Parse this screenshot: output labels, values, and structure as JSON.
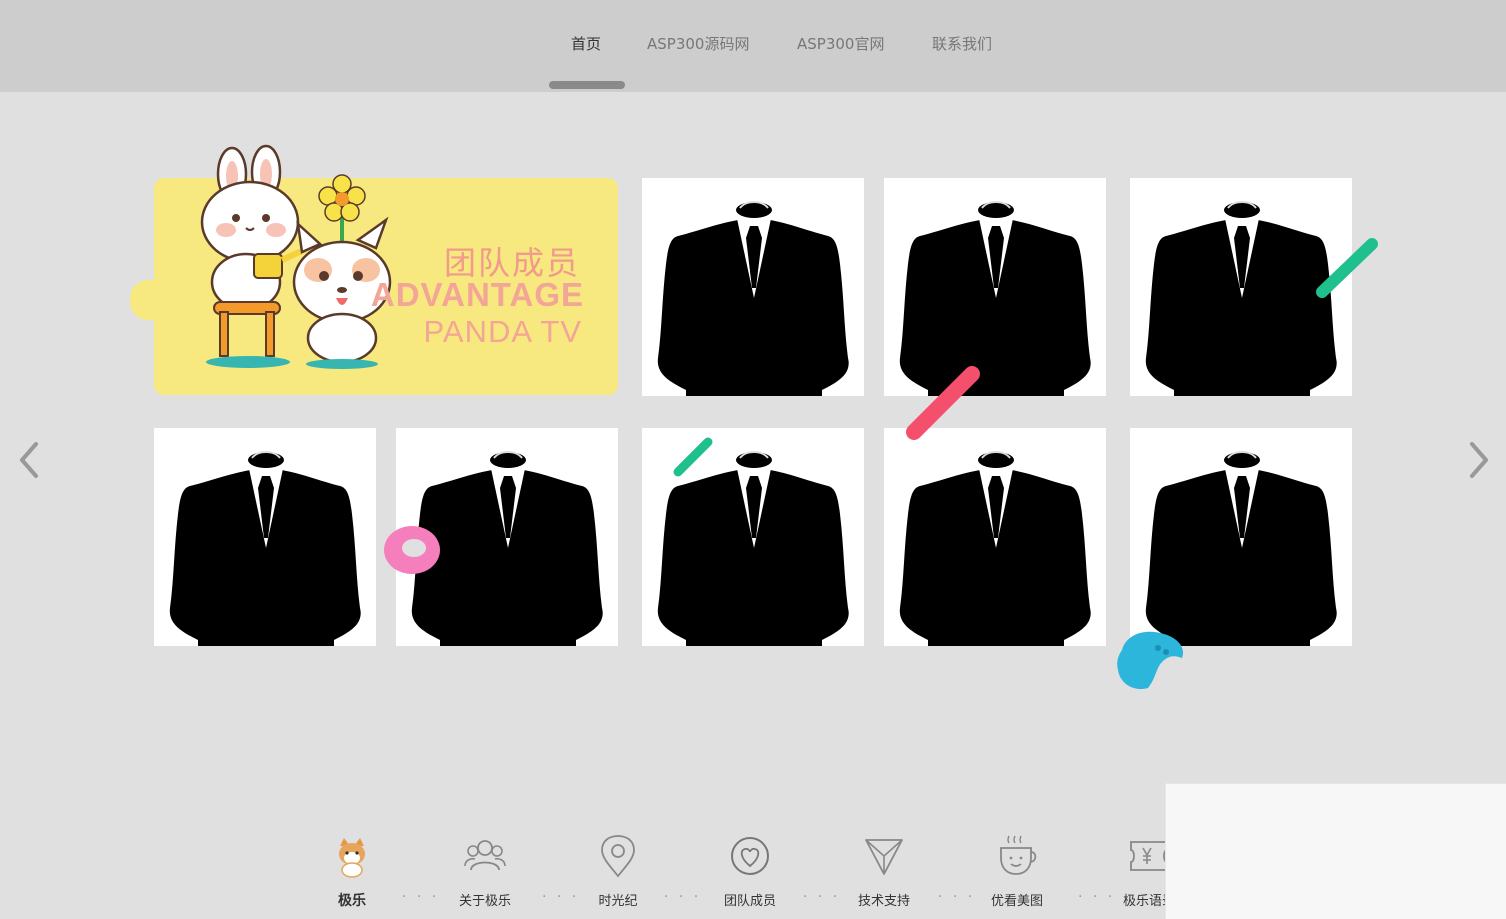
{
  "nav": {
    "items": [
      {
        "label": "首页"
      },
      {
        "label": "ASP300源码网"
      },
      {
        "label": "ASP300官网"
      },
      {
        "label": "联系我们"
      }
    ]
  },
  "banner": {
    "title": "团队成员",
    "subtitle": "ADVANTAGE",
    "subtitle2": "PANDA TV"
  },
  "bottom_menu": {
    "items": [
      {
        "label": "极乐",
        "icon": "shiba-dog-icon"
      },
      {
        "label": "关于极乐",
        "icon": "users-icon"
      },
      {
        "label": "时光纪",
        "icon": "location-pin-icon"
      },
      {
        "label": "团队成员",
        "icon": "heart-circle-icon"
      },
      {
        "label": "技术支持",
        "icon": "paper-plane-icon"
      },
      {
        "label": "优看美图",
        "icon": "coffee-cup-icon"
      },
      {
        "label": "极乐语录",
        "icon": "ticket-yen-icon"
      }
    ],
    "separator": "· · ·"
  },
  "colors": {
    "nav_bg": "#cdcdcd",
    "page_bg": "#e0e0e0",
    "banner_bg": "#f7e97f",
    "banner_text": "#f29a8c",
    "accent_pink": "#f4506e",
    "accent_green": "#1fc08e",
    "accent_blue": "#2cb6dc"
  }
}
